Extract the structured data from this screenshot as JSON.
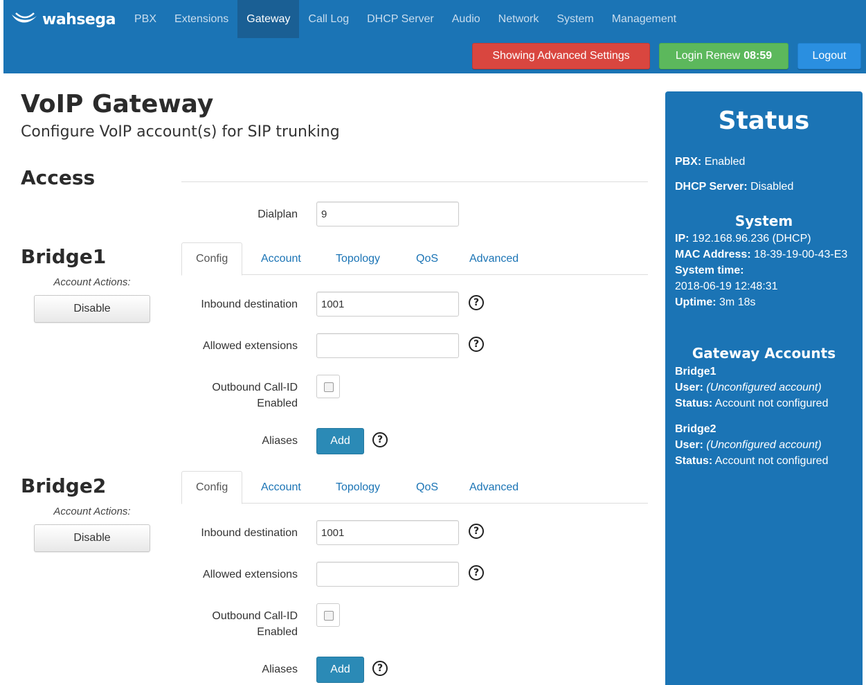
{
  "brand": {
    "name": "wahsega"
  },
  "nav": {
    "items": [
      "PBX",
      "Extensions",
      "Gateway",
      "Call Log",
      "DHCP Server",
      "Audio",
      "Network",
      "System",
      "Management"
    ],
    "active": "Gateway"
  },
  "header_buttons": {
    "advanced": "Showing Advanced Settings",
    "renew_label": "Login Renew",
    "renew_timer": "08:59",
    "logout": "Logout"
  },
  "page": {
    "title": "VoIP Gateway",
    "subtitle": "Configure VoIP account(s) for SIP trunking"
  },
  "access": {
    "title": "Access",
    "dialplan_label": "Dialplan",
    "dialplan_value": "9"
  },
  "tabs": [
    "Config",
    "Account",
    "Topology",
    "QoS",
    "Advanced"
  ],
  "bridges": [
    {
      "name": "Bridge1",
      "actions_label": "Account Actions:",
      "disable_label": "Disable",
      "inbound_label": "Inbound destination",
      "inbound_value": "1001",
      "allowed_label": "Allowed extensions",
      "allowed_value": "",
      "callid_label_1": "Outbound Call-ID",
      "callid_label_2": "Enabled",
      "callid_checked": false,
      "aliases_label": "Aliases",
      "add_label": "Add"
    },
    {
      "name": "Bridge2",
      "actions_label": "Account Actions:",
      "disable_label": "Disable",
      "inbound_label": "Inbound destination",
      "inbound_value": "1001",
      "allowed_label": "Allowed extensions",
      "allowed_value": "",
      "callid_label_1": "Outbound Call-ID",
      "callid_label_2": "Enabled",
      "callid_checked": false,
      "aliases_label": "Aliases",
      "add_label": "Add"
    }
  ],
  "help_glyph": "?",
  "status": {
    "title": "Status",
    "pbx_label": "PBX:",
    "pbx_value": "Enabled",
    "dhcp_label": "DHCP Server:",
    "dhcp_value": "Disabled",
    "system_title": "System",
    "ip_label": "IP:",
    "ip_value": "192.168.96.236 (DHCP)",
    "mac_label": "MAC Address:",
    "mac_value": "18-39-19-00-43-E3",
    "time_label": "System time:",
    "time_value": "2018-06-19 12:48:31",
    "uptime_label": "Uptime:",
    "uptime_value": "3m 18s",
    "gateway_title": "Gateway Accounts",
    "accounts": [
      {
        "name": "Bridge1",
        "user_label": "User:",
        "user_value": "(Unconfigured account)",
        "status_label": "Status:",
        "status_value": "Account not configured"
      },
      {
        "name": "Bridge2",
        "user_label": "User:",
        "user_value": "(Unconfigured account)",
        "status_label": "Status:",
        "status_value": "Account not configured"
      }
    ]
  },
  "colors": {
    "primary": "#1b74b5",
    "nav_active": "#1a5f94",
    "advanced_red": "#d9463f",
    "renew_green": "#5cb85c",
    "logout_blue": "#2a8fe0",
    "add_blue": "#2b8ab6"
  }
}
